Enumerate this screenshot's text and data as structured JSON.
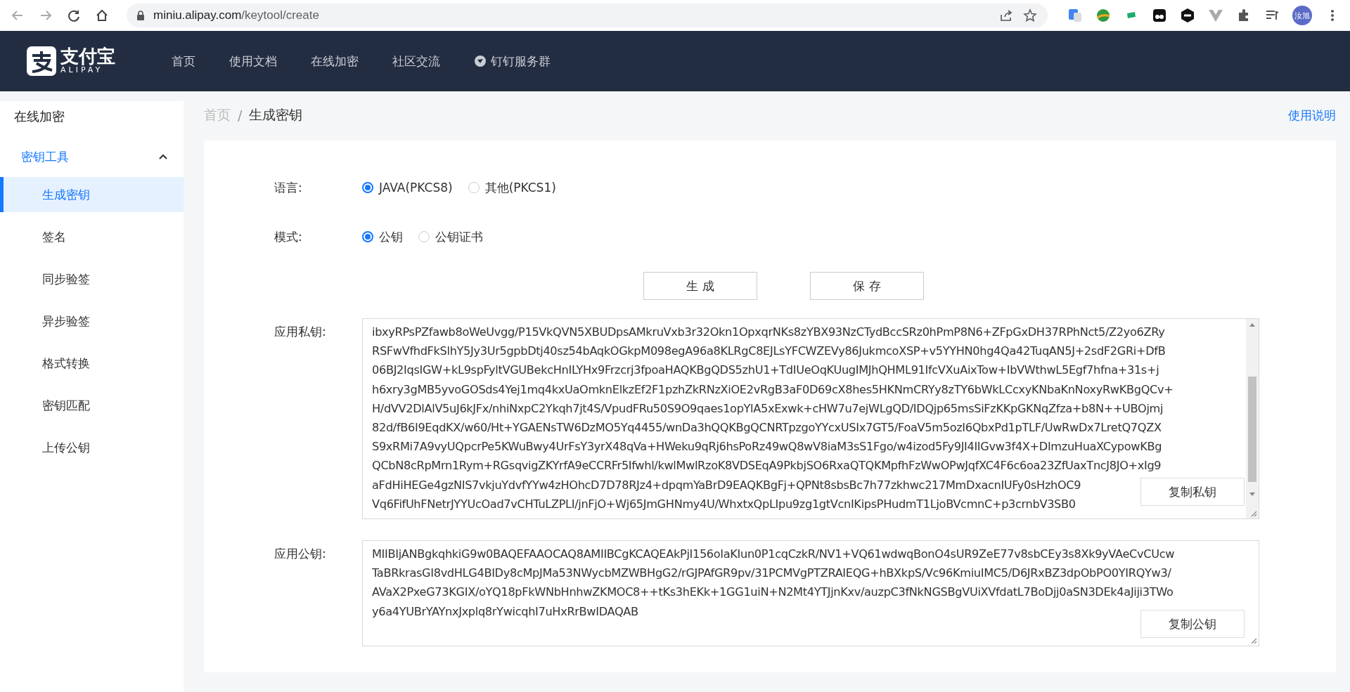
{
  "browser": {
    "url_host": "miniu.alipay.com",
    "url_path": "/keytool/create",
    "avatar_text": "汝旭"
  },
  "header": {
    "logo_text": "支付宝",
    "logo_sub": "ALIPAY",
    "nav": [
      {
        "label": "首页",
        "kind": "text"
      },
      {
        "label": "使用文档",
        "kind": "text"
      },
      {
        "label": "在线加密",
        "kind": "text"
      },
      {
        "label": "社区交流",
        "kind": "text"
      },
      {
        "label": "钉钉服务群",
        "kind": "icon"
      }
    ]
  },
  "sidebar": {
    "title": "在线加密",
    "group": {
      "label": "密钥工具",
      "expanded": true,
      "items": [
        {
          "label": "生成密钥",
          "selected": true
        },
        {
          "label": "签名",
          "selected": false
        },
        {
          "label": "同步验签",
          "selected": false
        },
        {
          "label": "异步验签",
          "selected": false
        },
        {
          "label": "格式转换",
          "selected": false
        },
        {
          "label": "密钥匹配",
          "selected": false
        },
        {
          "label": "上传公钥",
          "selected": false
        }
      ]
    }
  },
  "breadcrumb_separator": "/",
  "breadcrumb": [
    {
      "label": "首页"
    },
    {
      "label": "生成密钥"
    }
  ],
  "help_link": "使用说明",
  "form": {
    "language": {
      "label": "语言:",
      "options": [
        {
          "label": "JAVA(PKCS8)",
          "selected": true
        },
        {
          "label": "其他(PKCS1)",
          "selected": false
        }
      ]
    },
    "mode": {
      "label": "模式:",
      "options": [
        {
          "label": "公钥",
          "selected": true
        },
        {
          "label": "公钥证书",
          "selected": false
        }
      ]
    },
    "buttons": [
      "生 成",
      "保 存"
    ],
    "private_key": {
      "label": "应用私钥:",
      "copy_button": "复制私钥",
      "lines": [
        "ibxyRPsPZfawb8oWeUvgg/P15VkQVN5XBUDpsAMkruVxb3r32Okn1OpxqrNKs8zYBX93NzCTydBccSRz0hPmP8N6+ZFpGxDH37RPhNct5/Z2yo6ZRy",
        "RSFwVfhdFkSlhY5Jy3Ur5gpbDtj40sz54bAqkOGkpM098egA96a8KLRgC8EJLsYFCWZEVy86JukmcoXSP+v5YYHN0hg4Qa42TuqAN5J+2sdF2GRi+DfB",
        "06BJ2IqsIGW+kL9spFyltVGUBekcHnILYHx9Frzcrj3fpoaHAQKBgQDS5zhU1+TdIUeOqKUugIMJhQHML91IfcVXuAixTow+IbVWthwL5Egf7hfna+31s+j",
        "h6xry3gMB5yvoGOSds4Yej1mq4kxUaOmknElkzEf2F1pzhZkRNzXiOE2vRgB3aF0D69cX8hes5HKNmCRYy8zTY6bWkLCcxyKNbaKnNoxyRwKBgQCv+",
        "H/dVV2DlAlV5uJ6kJFx/nhiNxpC2Ykqh7jt4S/VpudFRu50S9O9qaes1opYlA5xExwk+cHW7u7ejWLgQD/IDQjp65msSiFzKKpGKNqZfza+b8N++UBOjmj",
        "82d/fB6I9EqdKX/w60/Ht+YGAENsTW6DzMO5Yq4455/wnDa3hQQKBgQCNRTpzgoYYcxUSIx7GT5/FoaV5m5ozI6QbxPd1pTLF/UwRwDx7LretQ7QZX",
        "S9xRMi7A9vyUQpcrPe5KWuBwy4UrFsY3yrX48qVa+HWeku9qRj6hsPoRz49wQ8wV8iaM3sS1Fgo/w4izod5Fy9JI4IIGvw3f4X+DImzuHuaXCypowKBg",
        "QCbN8cRpMrn1Rym+RGsqvigZKYrfA9eCCRFr5Ifwhl/kwlMwlRzoK8VDSEqA9PkbjSO6RxaQTQKMpfhFzWwOPwJqfXC4F6c6oa23ZfUaxTncJ8JO+xIg9",
        "aFdHiHEGe4gzNIS7vkjuYdvfYYw4zHOhcD7D78RJz4+dpqmYaBrD9EAQKBgFj+QPNt8sbsBc7h77zkhwc217MmDxacnIUFy0sHzhOC9",
        "Vq6FifUhFNetrJYYUcOad7vCHTuLZPLI/jnFjO+Wj65JmGHNmy4U/WhxtxQpLIpu9zg1gtVcnIKipsPHudmT1LjoBVcmnC+p3crnbV3SB0"
      ]
    },
    "public_key": {
      "label": "应用公钥:",
      "copy_button": "复制公钥",
      "lines": [
        "MIIBIjANBgkqhkiG9w0BAQEFAAOCAQ8AMIIBCgKCAQEAkPjI156oIaKIun0P1cqCzkR/NV1+VQ61wdwqBonO4sUR9ZeE77v8sbCEy3s8Xk9yVAeCvCUcw",
        "TaBRkrasGI8vdHLG4BIDy8cMpJMa53NWycbMZWBHgG2/rGJPAfGR9pv/31PCMVgPTZRAIEQG+hBXkpS/Vc96KmiuIMC5/D6JRxBZ3dpObPO0YIRQYw3/",
        "AVaX2PxeG73KGIX/oYQ18pFkWNbHnhwZKMOC8++tKs3hEKk+1GG1uiN+N2Mt4YTJjnKxv/auzpC3fNkNGSBgVUiXVfdatL7BoDjj0aSN3DEk4aJiji3TWo",
        "y6a4YUBrYAYnxJxplq8rYwicqhI7uHxRrBwIDAQAB"
      ]
    }
  }
}
